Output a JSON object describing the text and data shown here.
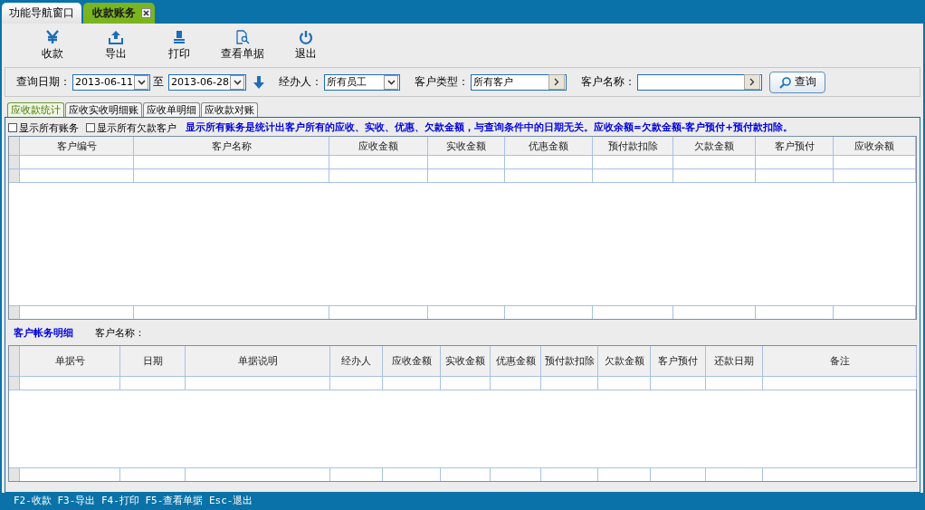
{
  "window_tabs": [
    {
      "label": "功能导航窗口",
      "selected": false
    },
    {
      "label": "收款账务",
      "selected": true
    }
  ],
  "toolbar": [
    {
      "label": "收款"
    },
    {
      "label": "导出"
    },
    {
      "label": "打印"
    },
    {
      "label": "查看单据"
    },
    {
      "label": "退出"
    }
  ],
  "filters": {
    "date_label": "查询日期：",
    "date_from": "2013-06-11",
    "date_sep": "至",
    "date_to": "2013-06-28",
    "handler_label": "经办人：",
    "handler": "所有员工",
    "customer_type_label": "客户类型：",
    "customer_type": "所有客户",
    "customer_name_label": "客户名称：",
    "query_button": "查询"
  },
  "sub_tabs": [
    {
      "label": "应收款统计",
      "selected": true
    },
    {
      "label": "应收实收明细账",
      "selected": false
    },
    {
      "label": "应收单明细",
      "selected": false
    },
    {
      "label": "应收款对账",
      "selected": false
    }
  ],
  "options": [
    {
      "label": "显示所有账务",
      "checked": false
    },
    {
      "label": "显示所有欠款客户",
      "checked": false
    }
  ],
  "note": "显示所有账务是统计出客户所有的应收、实收、优惠、欠款金额，与查询条件中的日期无关。应收余额=欠款金额-客户预付+预付款扣除。",
  "summary_table": {
    "columns": [
      "客户编号",
      "客户名称",
      "应收金额",
      "实收金额",
      "优惠金额",
      "预付款扣除",
      "欠款金额",
      "客户预付",
      "应收余额"
    ]
  },
  "detail": {
    "title": "客户帐务明细",
    "customer_label": "客户名称："
  },
  "detail_table": {
    "columns": [
      "单据号",
      "日期",
      "单据说明",
      "经办人",
      "应收金额",
      "实收金额",
      "优惠金额",
      "预付款扣除",
      "欠款金额",
      "客户预付",
      "还款日期",
      "备注"
    ]
  },
  "status_bar": "F2-收款 F3-导出 F4-打印 F5-查看单据 Esc-退出"
}
